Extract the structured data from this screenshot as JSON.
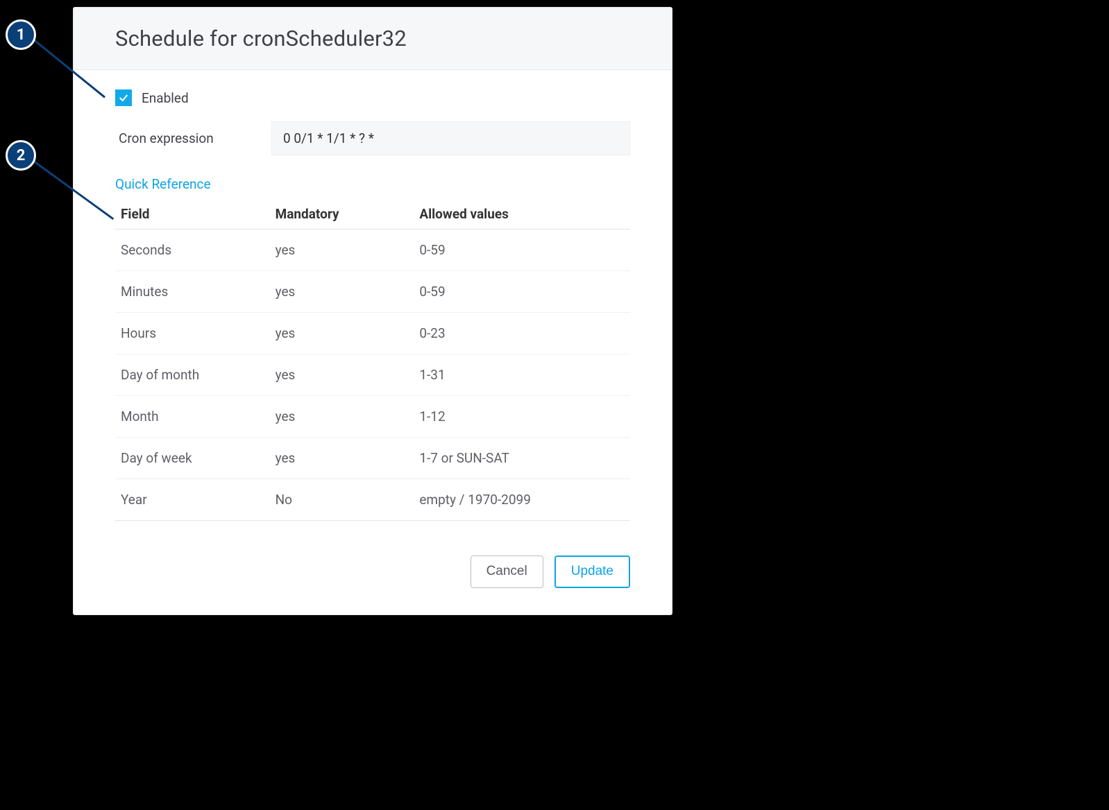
{
  "callouts": {
    "one": "1",
    "two": "2"
  },
  "header": {
    "title": "Schedule for cronScheduler32"
  },
  "form": {
    "enabled_label": "Enabled",
    "cron_label": "Cron expression",
    "cron_value": "0 0/1 * 1/1 * ? *"
  },
  "quick_ref": {
    "link_label": "Quick Reference",
    "columns": {
      "field": "Field",
      "mandatory": "Mandatory",
      "allowed": "Allowed values"
    },
    "rows": [
      {
        "field": "Seconds",
        "mandatory": "yes",
        "allowed": "0-59"
      },
      {
        "field": "Minutes",
        "mandatory": "yes",
        "allowed": "0-59"
      },
      {
        "field": "Hours",
        "mandatory": "yes",
        "allowed": "0-23"
      },
      {
        "field": "Day of month",
        "mandatory": "yes",
        "allowed": "1-31"
      },
      {
        "field": "Month",
        "mandatory": "yes",
        "allowed": "1-12"
      },
      {
        "field": "Day of week",
        "mandatory": "yes",
        "allowed": "1-7 or SUN-SAT"
      },
      {
        "field": "Year",
        "mandatory": "No",
        "allowed": "empty / 1970-2099"
      }
    ]
  },
  "buttons": {
    "cancel": "Cancel",
    "update": "Update"
  },
  "colors": {
    "accent": "#0ea4e3",
    "badge": "#0b3f77"
  }
}
